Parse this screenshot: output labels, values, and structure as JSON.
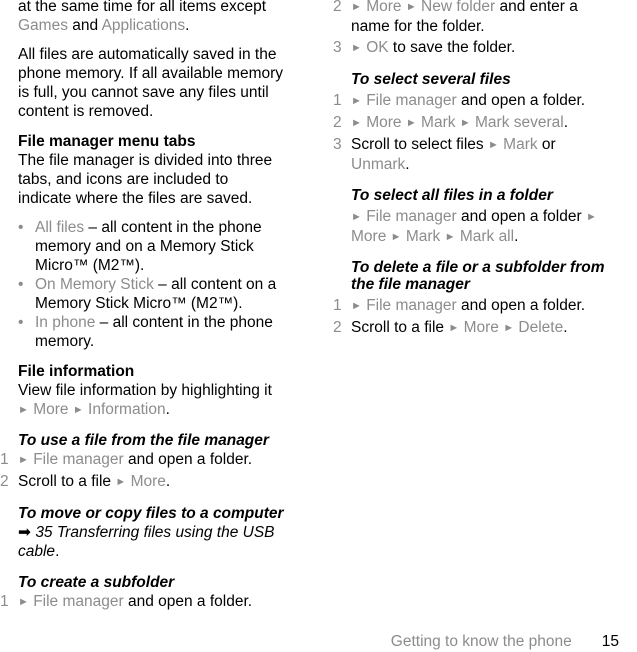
{
  "left": {
    "intro_a": "at the same time for all items except",
    "intro_games": "Games",
    "intro_and": " and ",
    "intro_apps": "Applications",
    "intro_end": ".",
    "saved_para": [
      "All files are automatically saved in the",
      "phone memory. If all available memory",
      "is full, you cannot save any files until",
      "content is removed."
    ],
    "tabs_heading": "File manager menu tabs",
    "tabs_para": [
      "The file manager is divided into three",
      "tabs, and icons are included to",
      "indicate where the files are saved."
    ],
    "bullets": [
      {
        "term": "All files",
        "text": [
          " – all content in the phone",
          "memory and on a Memory Stick",
          "Micro™ (M2™)."
        ]
      },
      {
        "term": "On Memory Stick",
        "text": [
          " – all content on a",
          "Memory Stick Micro™ (M2™)."
        ]
      },
      {
        "term": "In phone",
        "text": [
          " – all content in the phone",
          "memory."
        ]
      }
    ],
    "info_heading": "File information",
    "info_para": "View file information by highlighting it",
    "info_more": "More",
    "info_information": "Information",
    "use_heading": "To use a file from the file manager",
    "use_steps": [
      {
        "num": "1",
        "link": "File manager",
        "text": " and open a folder."
      },
      {
        "num": "2",
        "text": "Scroll to a file ",
        "link": "More",
        "end": "."
      }
    ],
    "move_heading": "To move or copy files to a computer",
    "move_ref": [
      "35 Transferring files using the USB",
      "cable"
    ],
    "move_ref_end": ".",
    "sub_heading": "To create a subfolder",
    "sub_step1": {
      "num": "1",
      "link": "File manager",
      "text": " and open a folder."
    }
  },
  "right": {
    "sub_step2": {
      "num": "2",
      "l1": "More",
      "l2": "New folder",
      "text": " and enter a",
      "text2": "name for the folder."
    },
    "sub_step3": {
      "num": "3",
      "link": "OK",
      "text": " to save the folder."
    },
    "several_heading": "To select several files",
    "several_steps": [
      {
        "num": "1",
        "link": "File manager",
        "text": " and open a folder."
      },
      {
        "num": "2",
        "l1": "More",
        "l2": "Mark",
        "l3": "Mark several",
        "end": "."
      },
      {
        "num": "3",
        "text": "Scroll to select files ",
        "l1": "Mark",
        "or": " or",
        "l2": "Unmark",
        "end": "."
      }
    ],
    "all_heading": "To select all files in a folder",
    "all_l1": "File manager",
    "all_text": " and open a folder ",
    "all_l2": "More",
    "all_l3": "Mark",
    "all_l4": "Mark all",
    "all_end": ".",
    "delete_heading": [
      "To delete a file or a subfolder from",
      "the file manager"
    ],
    "delete_steps": [
      {
        "num": "1",
        "link": "File manager",
        "text": " and open a folder."
      },
      {
        "num": "2",
        "text": "Scroll to a file ",
        "l1": "More",
        "l2": "Delete",
        "end": "."
      }
    ]
  },
  "footer": {
    "section": "Getting to know the phone",
    "page": "15"
  },
  "icons": {
    "arrow": "►",
    "ref_arrow": "➡",
    "bullet": "•"
  }
}
